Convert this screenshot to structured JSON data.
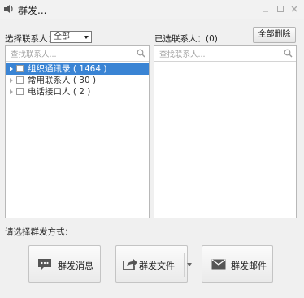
{
  "window": {
    "title": "群发...",
    "icon": "speaker-icon",
    "controls": [
      "minimize-icon",
      "maximize-icon",
      "close-icon"
    ]
  },
  "left": {
    "label": "选择联系人：",
    "select_value": "全部",
    "search_placeholder": "查找联系人...",
    "tree": [
      {
        "label": "组织通讯录 ( 1464 )",
        "selected": true
      },
      {
        "label": "常用联系人 ( 30 )",
        "selected": false
      },
      {
        "label": "电话接口人 ( 2 )",
        "selected": false
      }
    ]
  },
  "right": {
    "label": "已选联系人：(0)",
    "clear_button": "全部删除",
    "search_placeholder": "查找联系人..."
  },
  "method": {
    "label": "请选择群发方式：",
    "buttons": [
      {
        "label": "群发消息",
        "icon": "chat-icon"
      },
      {
        "label": "群发文件",
        "icon": "share-file-icon"
      },
      {
        "label": "群发邮件",
        "icon": "mail-icon"
      }
    ]
  },
  "colors": {
    "selection": "#3a84d4",
    "background": "#f0f0f0"
  }
}
